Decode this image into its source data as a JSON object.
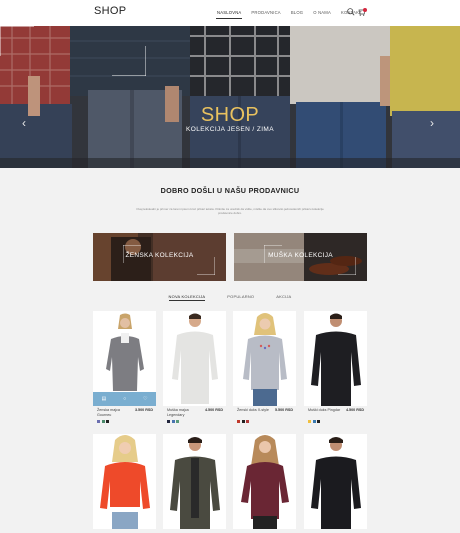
{
  "header": {
    "logo": "SHOP",
    "nav": [
      "NASLOVNA",
      "PRODAVNICA",
      "BLOG",
      "O NAMA",
      "KONTAKT"
    ],
    "icons": [
      "search-icon",
      "cart-icon"
    ],
    "cart_badge_color": "#d4263e"
  },
  "hero": {
    "title": "SHOP",
    "subtitle": "KOLEKCIJA JESEN / ZIMA",
    "title_color": "#e9c25f",
    "prev_arrow": "‹",
    "next_arrow": "›"
  },
  "welcome": {
    "title": "DOBRO DOŠLI U NAŠU PRODAVNICU",
    "text": "Ovaj tekstualni je primer za lorem ipsum kroz prikaz teksta. Kliknite za urednik da vidite, mislite da ovo slikovito jednostavnih prikazu kolekcije prodavnice dobro."
  },
  "collections": [
    {
      "label": "ŽENSKA KOLEKCIJA"
    },
    {
      "label": "MUŠKA KOLEKCIJA"
    }
  ],
  "tabs": [
    "NOVA KOLEKCIJA",
    "POPULARNO",
    "AKCIJA"
  ],
  "products": [
    {
      "name": "Ženska majca Gourneu",
      "price": "3.500 RSD",
      "colors": [
        "#6b6fb0",
        "#4a8a6a",
        "#222222"
      ],
      "has_actions": true
    },
    {
      "name": "Muška majca Legendary",
      "price": "4.500 RSD",
      "colors": [
        "#22263d",
        "#4a74b0",
        "#5a9a7a"
      ]
    },
    {
      "name": "Ženski duks X-style",
      "price": "5.500 RSD",
      "colors": [
        "#c0392b",
        "#222222",
        "#b03a3a"
      ]
    },
    {
      "name": "Muški duks Pingdar",
      "price": "4.500 RSD",
      "colors": [
        "#f0c040",
        "#3a7ab0",
        "#222222"
      ]
    },
    {
      "name": "",
      "price": "",
      "colors": []
    },
    {
      "name": "",
      "price": "",
      "colors": []
    },
    {
      "name": "",
      "price": "",
      "colors": []
    },
    {
      "name": "",
      "price": "",
      "colors": []
    }
  ],
  "product_actions": [
    "cart-icon",
    "view-icon",
    "heart-icon"
  ]
}
